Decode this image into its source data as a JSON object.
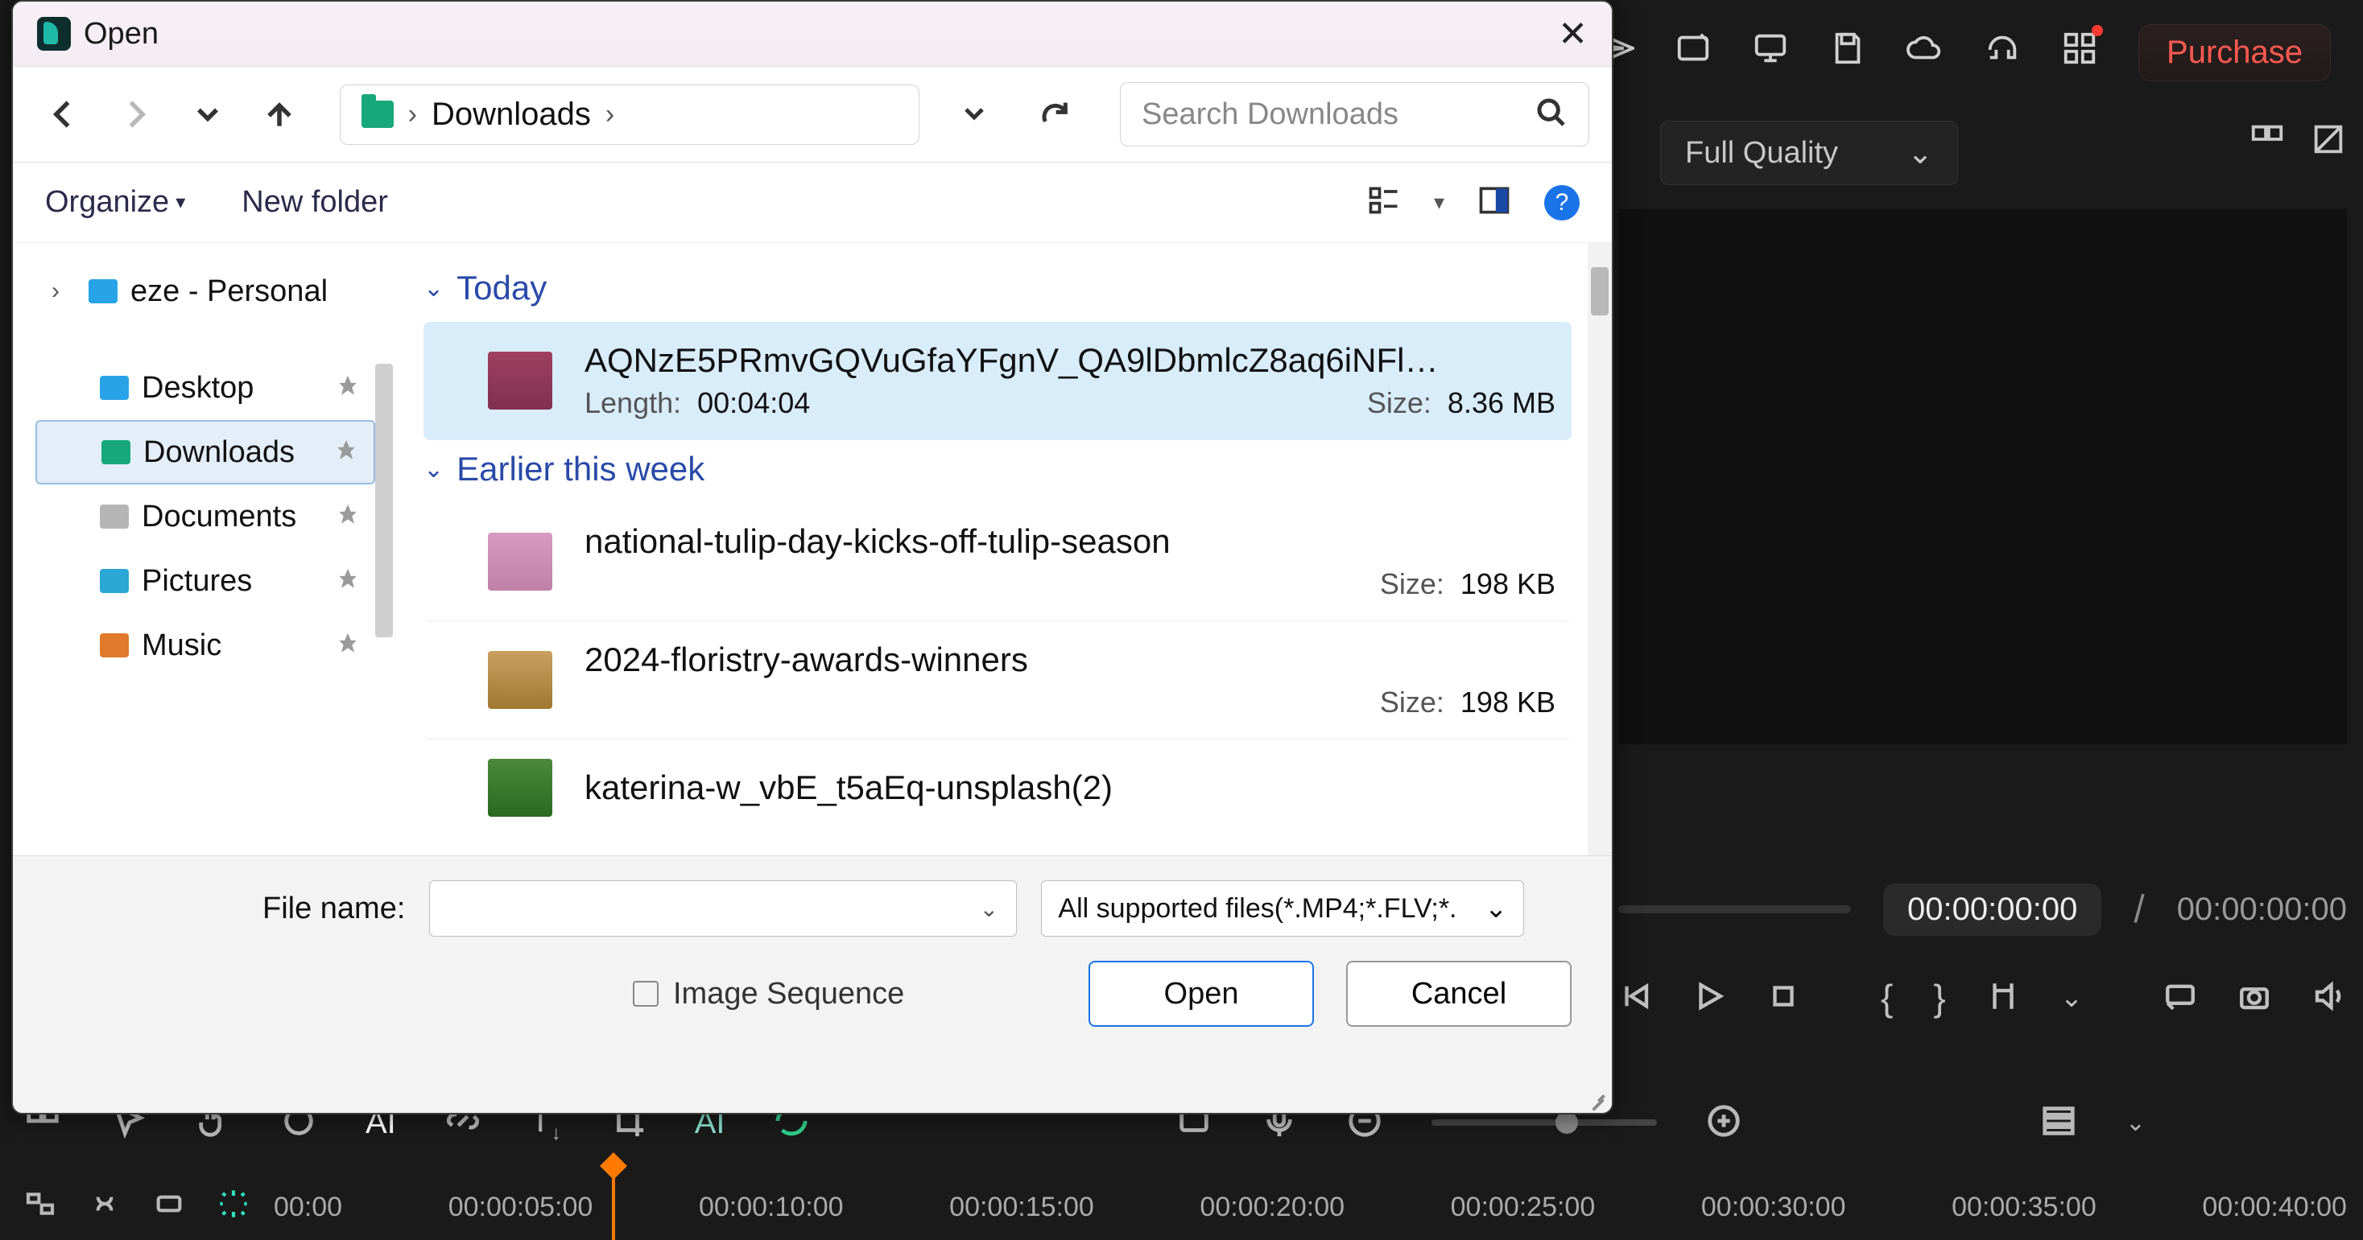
{
  "editor": {
    "top_icons": [
      "send-icon",
      "media-import-icon",
      "monitor-icon",
      "save-icon",
      "cloud-icon",
      "headset-icon",
      "apps-icon"
    ],
    "purchase": "Purchase",
    "quality_label": "Full Quality",
    "timecode_current": "00:00:00:00",
    "timecode_total": "00:00:00:00",
    "ruler_marks": [
      "00:00",
      "00:00:05:00",
      "00:00:10:00",
      "00:00:15:00",
      "00:00:20:00",
      "00:00:25:00",
      "00:00:30:00",
      "00:00:35:00",
      "00:00:40:00"
    ]
  },
  "dialog": {
    "title": "Open",
    "breadcrumb": {
      "location": "Downloads"
    },
    "search_placeholder": "Search Downloads",
    "toolbar": {
      "organize": "Organize",
      "new_folder": "New folder"
    },
    "sidebar": {
      "personal": "eze - Personal",
      "items": [
        {
          "label": "Desktop",
          "color": "folder-blue"
        },
        {
          "label": "Downloads",
          "color": "folder-teal",
          "active": true
        },
        {
          "label": "Documents",
          "color": "folder-gray"
        },
        {
          "label": "Pictures",
          "color": "folder-cyan"
        },
        {
          "label": "Music",
          "color": "folder-orange"
        }
      ]
    },
    "groups": [
      {
        "heading": "Today",
        "files": [
          {
            "name": "AQNzE5PRmvGQVuGfaYFgnV_QA9lDbmlcZ8aq6iNFl…",
            "length_label": "Length:",
            "length": "00:04:04",
            "size_label": "Size:",
            "size": "8.36 MB",
            "thumb": "pink",
            "selected": true
          }
        ]
      },
      {
        "heading": "Earlier this week",
        "files": [
          {
            "name": "national-tulip-day-kicks-off-tulip-season",
            "size_label": "Size:",
            "size": "198 KB",
            "thumb": "flowers"
          },
          {
            "name": "2024-floristry-awards-winners",
            "size_label": "Size:",
            "size": "198 KB",
            "thumb": "people"
          },
          {
            "name": "katerina-w_vbE_t5aEq-unsplash(2)",
            "thumb": "green"
          }
        ]
      }
    ],
    "footer": {
      "filename_label": "File name:",
      "filename_value": "",
      "type_filter": "All supported files(*.MP4;*.FLV;*.",
      "image_sequence": "Image Sequence",
      "open": "Open",
      "cancel": "Cancel"
    }
  }
}
